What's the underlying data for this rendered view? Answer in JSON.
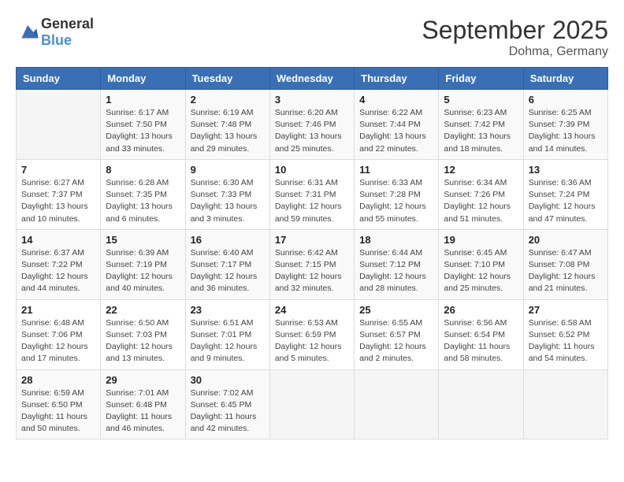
{
  "header": {
    "logo_general": "General",
    "logo_blue": "Blue",
    "month": "September 2025",
    "location": "Dohma, Germany"
  },
  "weekdays": [
    "Sunday",
    "Monday",
    "Tuesday",
    "Wednesday",
    "Thursday",
    "Friday",
    "Saturday"
  ],
  "weeks": [
    [
      {
        "day": "",
        "sunrise": "",
        "sunset": "",
        "daylight": ""
      },
      {
        "day": "1",
        "sunrise": "Sunrise: 6:17 AM",
        "sunset": "Sunset: 7:50 PM",
        "daylight": "Daylight: 13 hours and 33 minutes."
      },
      {
        "day": "2",
        "sunrise": "Sunrise: 6:19 AM",
        "sunset": "Sunset: 7:48 PM",
        "daylight": "Daylight: 13 hours and 29 minutes."
      },
      {
        "day": "3",
        "sunrise": "Sunrise: 6:20 AM",
        "sunset": "Sunset: 7:46 PM",
        "daylight": "Daylight: 13 hours and 25 minutes."
      },
      {
        "day": "4",
        "sunrise": "Sunrise: 6:22 AM",
        "sunset": "Sunset: 7:44 PM",
        "daylight": "Daylight: 13 hours and 22 minutes."
      },
      {
        "day": "5",
        "sunrise": "Sunrise: 6:23 AM",
        "sunset": "Sunset: 7:42 PM",
        "daylight": "Daylight: 13 hours and 18 minutes."
      },
      {
        "day": "6",
        "sunrise": "Sunrise: 6:25 AM",
        "sunset": "Sunset: 7:39 PM",
        "daylight": "Daylight: 13 hours and 14 minutes."
      }
    ],
    [
      {
        "day": "7",
        "sunrise": "Sunrise: 6:27 AM",
        "sunset": "Sunset: 7:37 PM",
        "daylight": "Daylight: 13 hours and 10 minutes."
      },
      {
        "day": "8",
        "sunrise": "Sunrise: 6:28 AM",
        "sunset": "Sunset: 7:35 PM",
        "daylight": "Daylight: 13 hours and 6 minutes."
      },
      {
        "day": "9",
        "sunrise": "Sunrise: 6:30 AM",
        "sunset": "Sunset: 7:33 PM",
        "daylight": "Daylight: 13 hours and 3 minutes."
      },
      {
        "day": "10",
        "sunrise": "Sunrise: 6:31 AM",
        "sunset": "Sunset: 7:31 PM",
        "daylight": "Daylight: 12 hours and 59 minutes."
      },
      {
        "day": "11",
        "sunrise": "Sunrise: 6:33 AM",
        "sunset": "Sunset: 7:28 PM",
        "daylight": "Daylight: 12 hours and 55 minutes."
      },
      {
        "day": "12",
        "sunrise": "Sunrise: 6:34 AM",
        "sunset": "Sunset: 7:26 PM",
        "daylight": "Daylight: 12 hours and 51 minutes."
      },
      {
        "day": "13",
        "sunrise": "Sunrise: 6:36 AM",
        "sunset": "Sunset: 7:24 PM",
        "daylight": "Daylight: 12 hours and 47 minutes."
      }
    ],
    [
      {
        "day": "14",
        "sunrise": "Sunrise: 6:37 AM",
        "sunset": "Sunset: 7:22 PM",
        "daylight": "Daylight: 12 hours and 44 minutes."
      },
      {
        "day": "15",
        "sunrise": "Sunrise: 6:39 AM",
        "sunset": "Sunset: 7:19 PM",
        "daylight": "Daylight: 12 hours and 40 minutes."
      },
      {
        "day": "16",
        "sunrise": "Sunrise: 6:40 AM",
        "sunset": "Sunset: 7:17 PM",
        "daylight": "Daylight: 12 hours and 36 minutes."
      },
      {
        "day": "17",
        "sunrise": "Sunrise: 6:42 AM",
        "sunset": "Sunset: 7:15 PM",
        "daylight": "Daylight: 12 hours and 32 minutes."
      },
      {
        "day": "18",
        "sunrise": "Sunrise: 6:44 AM",
        "sunset": "Sunset: 7:12 PM",
        "daylight": "Daylight: 12 hours and 28 minutes."
      },
      {
        "day": "19",
        "sunrise": "Sunrise: 6:45 AM",
        "sunset": "Sunset: 7:10 PM",
        "daylight": "Daylight: 12 hours and 25 minutes."
      },
      {
        "day": "20",
        "sunrise": "Sunrise: 6:47 AM",
        "sunset": "Sunset: 7:08 PM",
        "daylight": "Daylight: 12 hours and 21 minutes."
      }
    ],
    [
      {
        "day": "21",
        "sunrise": "Sunrise: 6:48 AM",
        "sunset": "Sunset: 7:06 PM",
        "daylight": "Daylight: 12 hours and 17 minutes."
      },
      {
        "day": "22",
        "sunrise": "Sunrise: 6:50 AM",
        "sunset": "Sunset: 7:03 PM",
        "daylight": "Daylight: 12 hours and 13 minutes."
      },
      {
        "day": "23",
        "sunrise": "Sunrise: 6:51 AM",
        "sunset": "Sunset: 7:01 PM",
        "daylight": "Daylight: 12 hours and 9 minutes."
      },
      {
        "day": "24",
        "sunrise": "Sunrise: 6:53 AM",
        "sunset": "Sunset: 6:59 PM",
        "daylight": "Daylight: 12 hours and 5 minutes."
      },
      {
        "day": "25",
        "sunrise": "Sunrise: 6:55 AM",
        "sunset": "Sunset: 6:57 PM",
        "daylight": "Daylight: 12 hours and 2 minutes."
      },
      {
        "day": "26",
        "sunrise": "Sunrise: 6:56 AM",
        "sunset": "Sunset: 6:54 PM",
        "daylight": "Daylight: 11 hours and 58 minutes."
      },
      {
        "day": "27",
        "sunrise": "Sunrise: 6:58 AM",
        "sunset": "Sunset: 6:52 PM",
        "daylight": "Daylight: 11 hours and 54 minutes."
      }
    ],
    [
      {
        "day": "28",
        "sunrise": "Sunrise: 6:59 AM",
        "sunset": "Sunset: 6:50 PM",
        "daylight": "Daylight: 11 hours and 50 minutes."
      },
      {
        "day": "29",
        "sunrise": "Sunrise: 7:01 AM",
        "sunset": "Sunset: 6:48 PM",
        "daylight": "Daylight: 11 hours and 46 minutes."
      },
      {
        "day": "30",
        "sunrise": "Sunrise: 7:02 AM",
        "sunset": "Sunset: 6:45 PM",
        "daylight": "Daylight: 11 hours and 42 minutes."
      },
      {
        "day": "",
        "sunrise": "",
        "sunset": "",
        "daylight": ""
      },
      {
        "day": "",
        "sunrise": "",
        "sunset": "",
        "daylight": ""
      },
      {
        "day": "",
        "sunrise": "",
        "sunset": "",
        "daylight": ""
      },
      {
        "day": "",
        "sunrise": "",
        "sunset": "",
        "daylight": ""
      }
    ]
  ]
}
